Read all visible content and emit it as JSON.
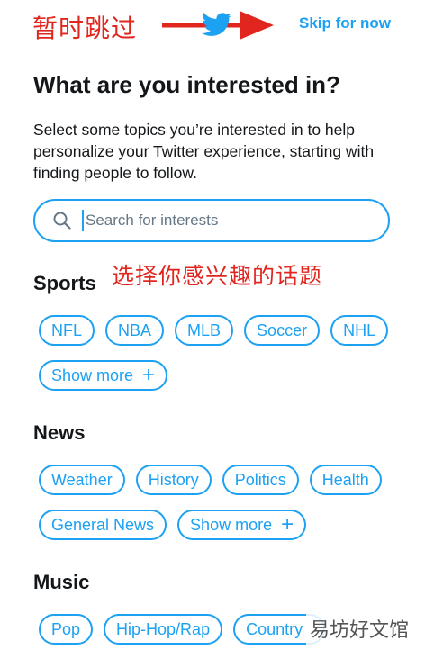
{
  "annotations": {
    "top_note": "暂时跳过",
    "middle_note": "选择你感兴趣的话题"
  },
  "header": {
    "skip_label": "Skip for now"
  },
  "page": {
    "title": "What are you interested in?",
    "subtitle": "Select some topics you’re interested in to help personalize your Twitter experience, starting with finding people to follow."
  },
  "search": {
    "placeholder": "Search for interests"
  },
  "sections": {
    "sports": {
      "title": "Sports",
      "chips": [
        "NFL",
        "NBA",
        "MLB",
        "Soccer",
        "NHL"
      ],
      "show_more": "Show more"
    },
    "news": {
      "title": "News",
      "chips": [
        "Weather",
        "History",
        "Politics",
        "Health",
        "General News"
      ],
      "show_more": "Show more"
    },
    "music": {
      "title": "Music",
      "chips": [
        "Pop",
        "Hip-Hop/Rap",
        "Country"
      ]
    }
  },
  "watermark": {
    "text": "易坊好文馆"
  },
  "colors": {
    "accent": "#1da1f2",
    "annotation": "#e0261f",
    "text": "#14171a"
  },
  "icons": [
    "twitter-bird-icon",
    "search-icon",
    "plus-icon",
    "red-arrow"
  ]
}
